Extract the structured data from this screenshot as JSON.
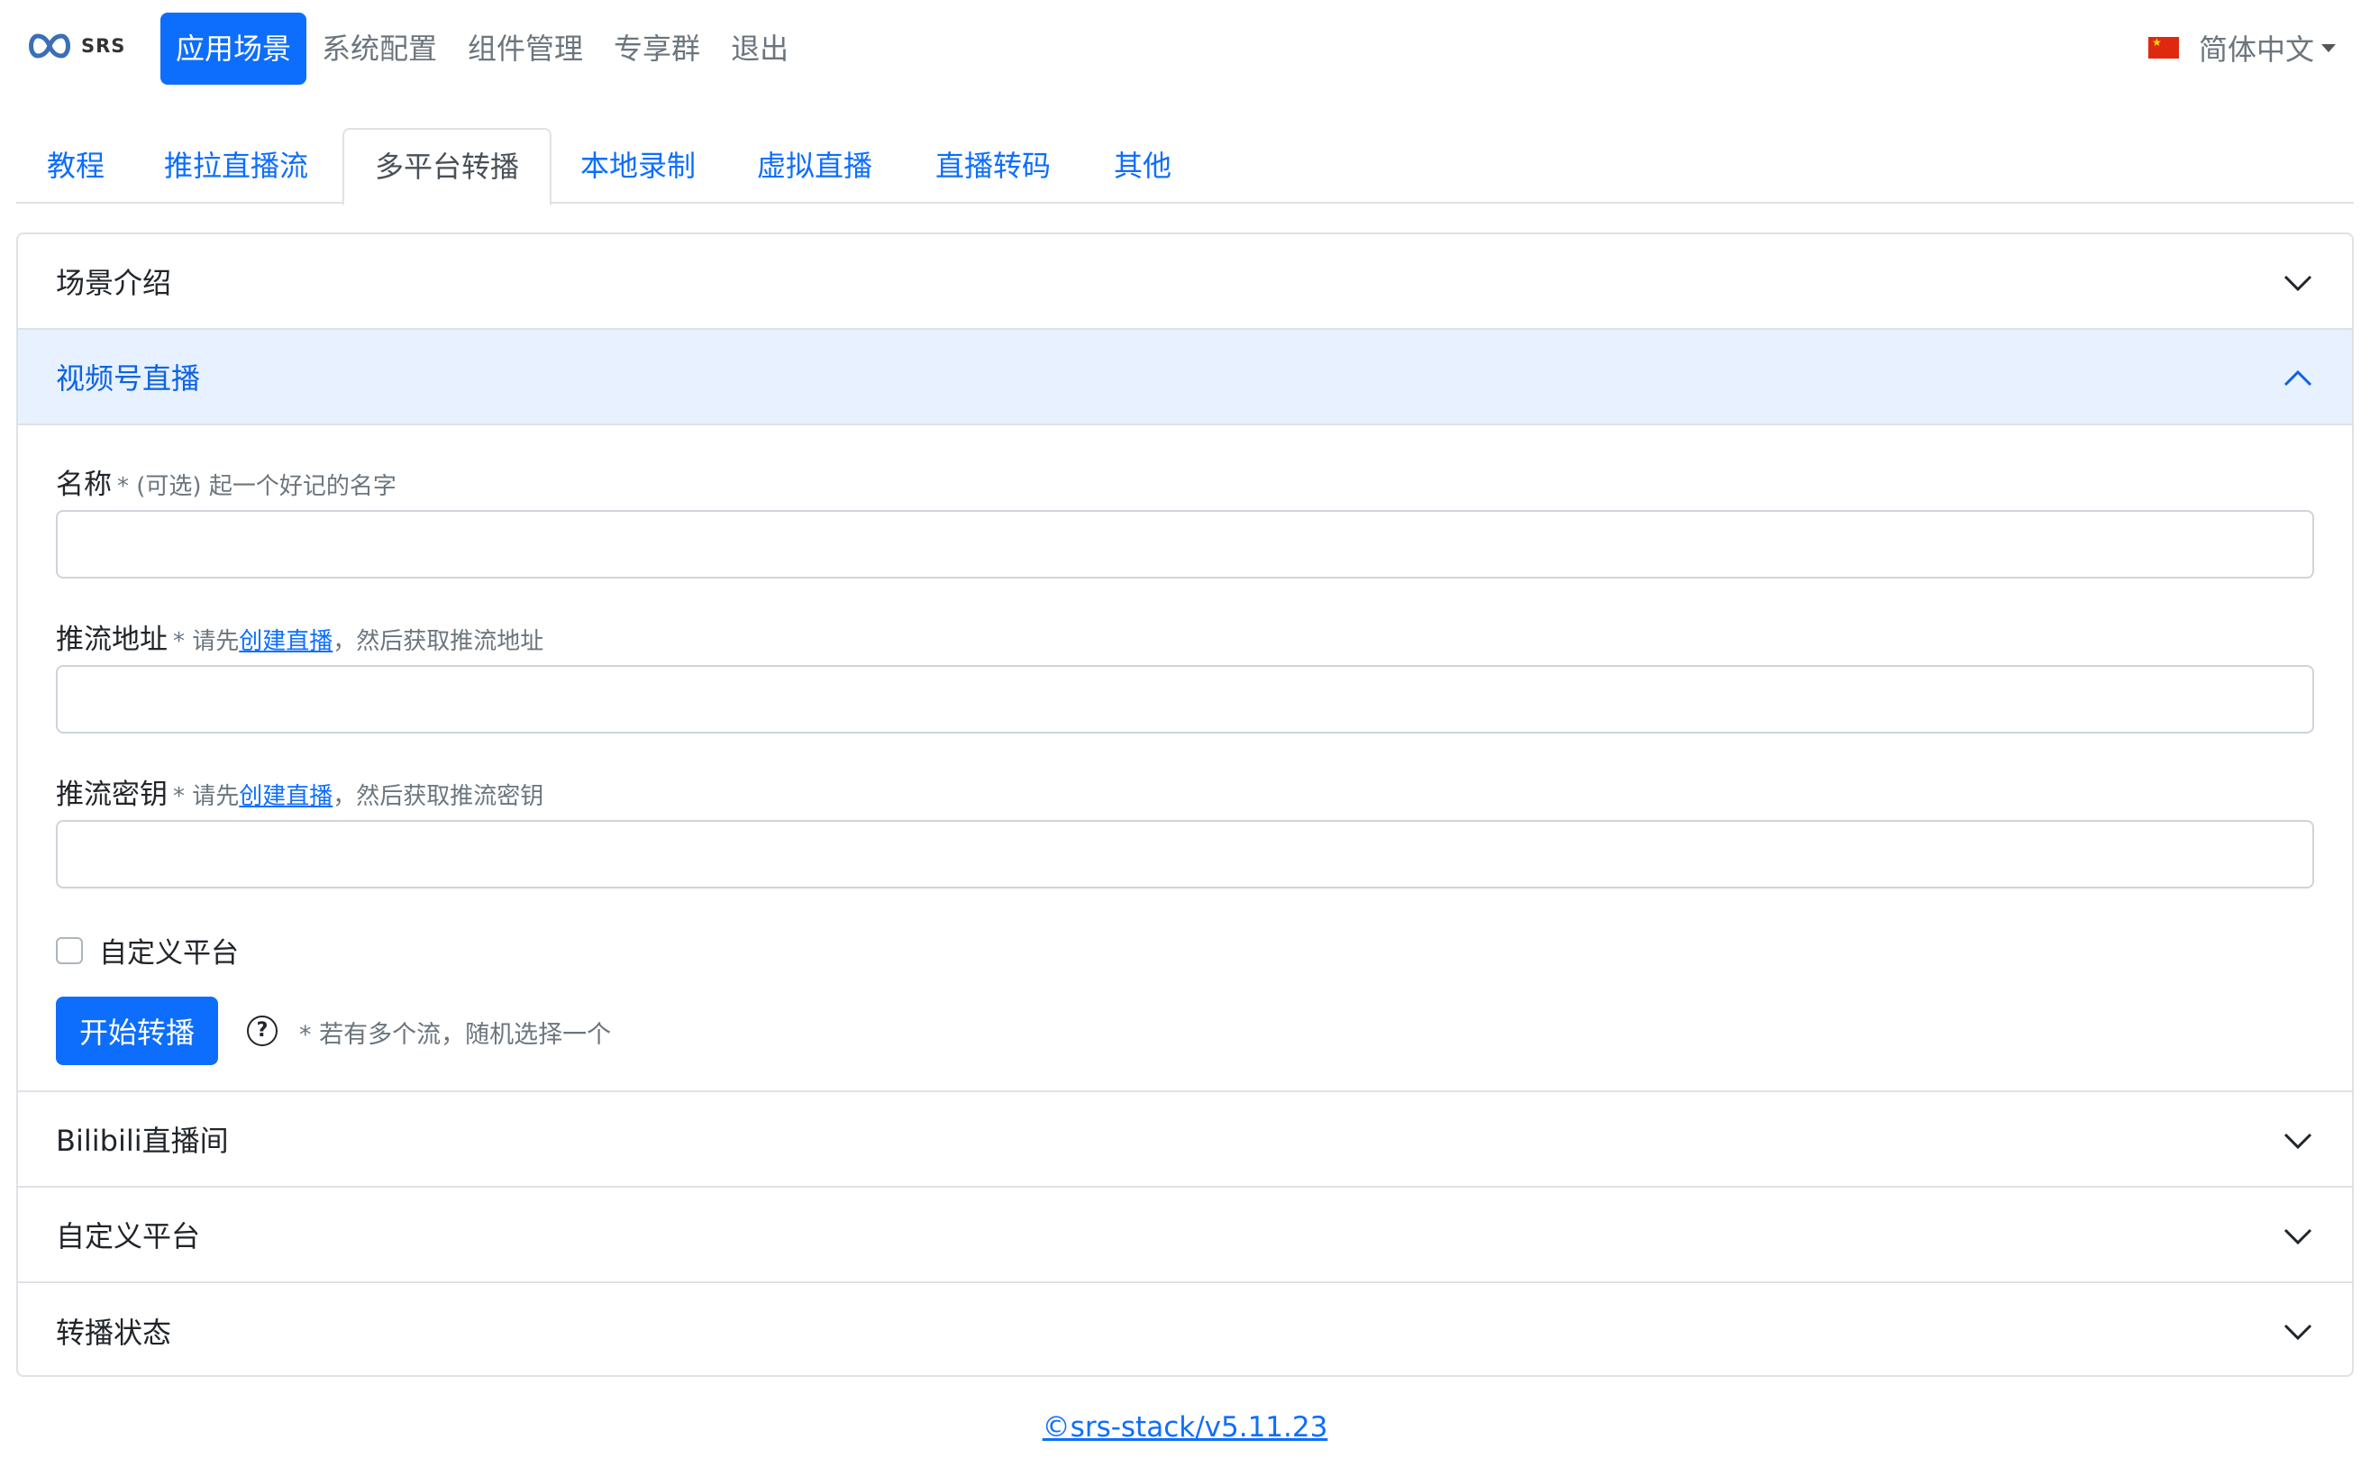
{
  "brand": {
    "logo_text": "SRS"
  },
  "nav": {
    "items": [
      {
        "label": "应用场景",
        "active": true
      },
      {
        "label": "系统配置",
        "active": false
      },
      {
        "label": "组件管理",
        "active": false
      },
      {
        "label": "专享群",
        "active": false
      },
      {
        "label": "退出",
        "active": false
      }
    ],
    "language": "简体中文"
  },
  "tabs": [
    {
      "label": "教程"
    },
    {
      "label": "推拉直播流"
    },
    {
      "label": "多平台转播",
      "active": true
    },
    {
      "label": "本地录制"
    },
    {
      "label": "虚拟直播"
    },
    {
      "label": "直播转码"
    },
    {
      "label": "其他"
    }
  ],
  "accordion": {
    "intro": "场景介绍",
    "wechat": "视频号直播",
    "bilibili": "Bilibili直播间",
    "custom": "自定义平台",
    "status": "转播状态"
  },
  "form": {
    "name_label": "名称",
    "name_hint": "* (可选) 起一个好记的名字",
    "name_value": "",
    "server_label": "推流地址",
    "server_hint_pre": "* 请先",
    "server_link": "创建直播",
    "server_hint_post": "，然后获取推流地址",
    "server_value": "",
    "key_label": "推流密钥",
    "key_hint_pre": "* 请先",
    "key_link": "创建直播",
    "key_hint_post": "，然后获取推流密钥",
    "key_value": "",
    "custom_checkbox": "自定义平台",
    "custom_checked": false,
    "start_button": "开始转播",
    "start_hint": "* 若有多个流，随机选择一个"
  },
  "footer": {
    "version_link": "©srs-stack/v5.11.23"
  },
  "colors": {
    "primary": "#0d6efd",
    "open_header_bg": "#e7f1ff"
  }
}
